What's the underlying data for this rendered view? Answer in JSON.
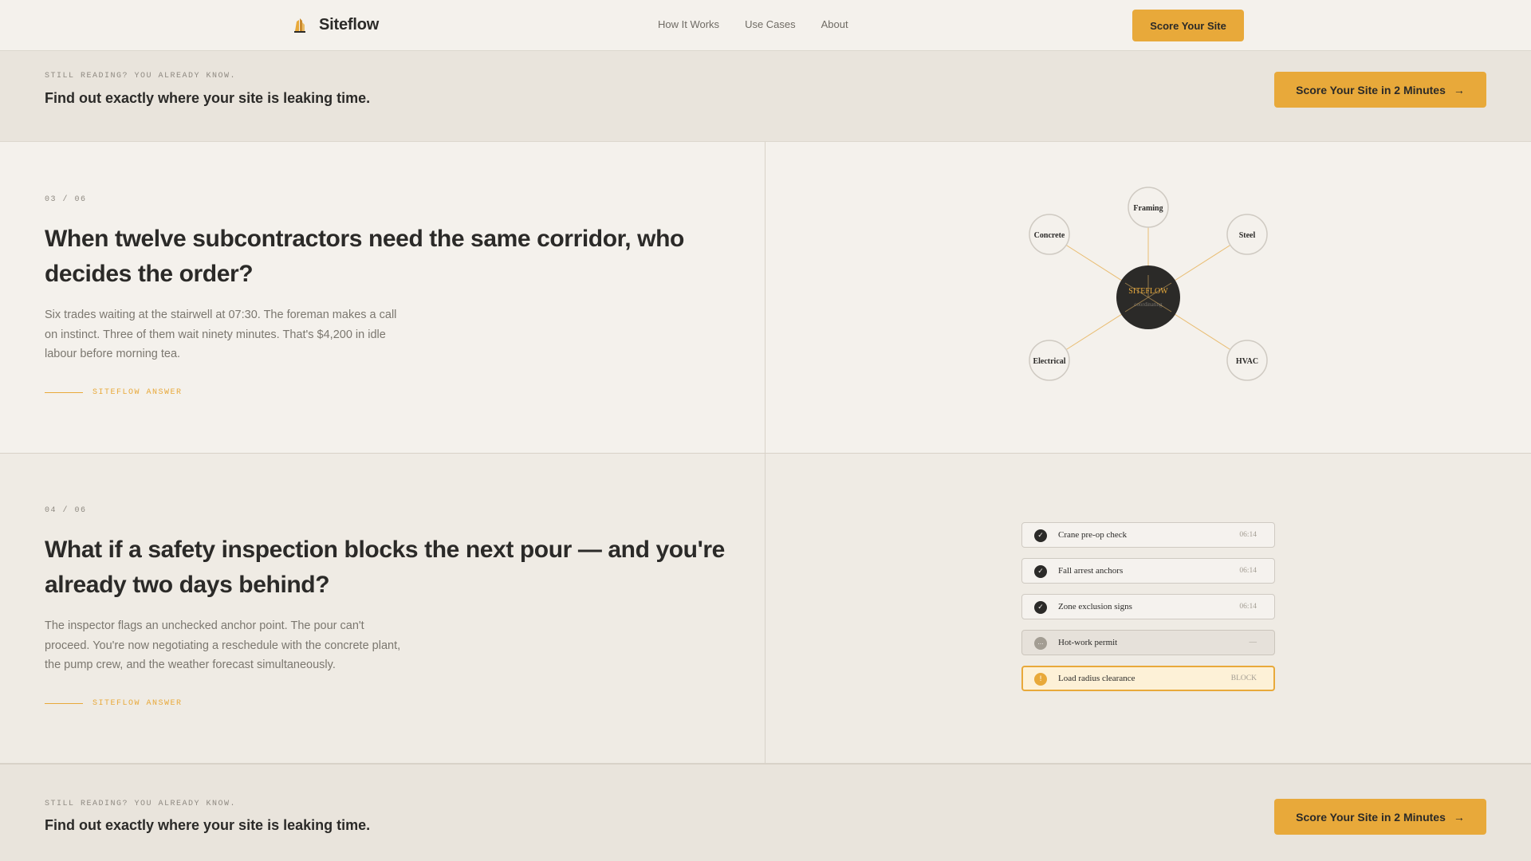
{
  "nav": {
    "brand": "Siteflow",
    "links": [
      "How It Works",
      "Use Cases",
      "About"
    ],
    "cta": "Score Your Site"
  },
  "cta_band": {
    "kicker": "STILL READING? YOU ALREADY KNOW.",
    "headline": "Find out exactly where your site is leaking time.",
    "button": "Score Your Site in 2 Minutes"
  },
  "sections": [
    {
      "index": "03 / 06",
      "title": "When twelve subcontractors need the same corridor, who decides the order?",
      "body": "Six trades waiting at the stairwell at 07:30. The foreman makes a call on instinct. Three of them wait ninety minutes. That's $4,200 in idle labour before morning tea.",
      "answer": "SITEFLOW ANSWER"
    },
    {
      "index": "04 / 06",
      "title": "What if a safety inspection blocks the next pour — and you're already two days behind?",
      "body": "The inspector flags an unchecked anchor point. The pour can't proceed. You're now negotiating a reschedule with the concrete plant, the pump crew, and the weather forecast simultaneously.",
      "answer": "SITEFLOW ANSWER"
    }
  ],
  "hub": {
    "center_label": "SITEFLOW",
    "center_sub": "coordinating",
    "nodes": [
      "Framing",
      "Concrete",
      "Steel",
      "Electrical",
      "HVAC"
    ]
  },
  "checklist": [
    {
      "label": "Crane pre-op check",
      "status": "done",
      "mark": "✓",
      "time": "06:14"
    },
    {
      "label": "Fall arrest anchors",
      "status": "done",
      "mark": "✓",
      "time": "06:14"
    },
    {
      "label": "Zone exclusion signs",
      "status": "done",
      "mark": "✓",
      "time": "06:14"
    },
    {
      "label": "Hot-work permit",
      "status": "pending",
      "mark": "...",
      "time": "—"
    },
    {
      "label": "Load radius clearance",
      "status": "block",
      "mark": "!",
      "time": "BLOCK"
    }
  ],
  "colors": {
    "accent": "#e8a93a",
    "dark": "#2b2a28",
    "background": "#f4f1ec",
    "band": "#e9e4dc"
  }
}
